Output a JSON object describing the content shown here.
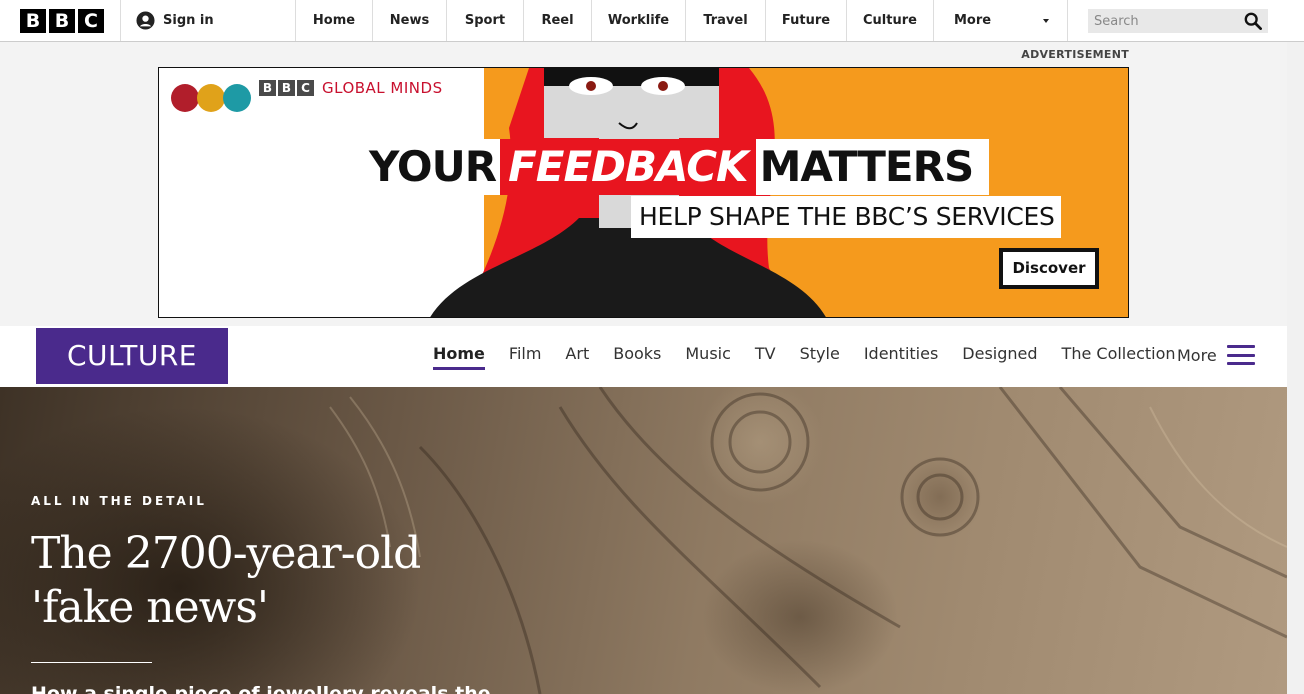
{
  "global_nav": {
    "logo_letters": [
      "B",
      "B",
      "C"
    ],
    "signin_label": "Sign in",
    "links": [
      {
        "label": "Home",
        "width": 77
      },
      {
        "label": "News",
        "width": 74
      },
      {
        "label": "Sport",
        "width": 77
      },
      {
        "label": "Reel",
        "width": 68
      },
      {
        "label": "Worklife",
        "width": 94
      },
      {
        "label": "Travel",
        "width": 80
      },
      {
        "label": "Future",
        "width": 81
      },
      {
        "label": "Culture",
        "width": 87
      }
    ],
    "more_label": "More",
    "search_placeholder": "Search"
  },
  "advertisement": {
    "label": "ADVERTISEMENT",
    "brand_letters": [
      "B",
      "B",
      "C"
    ],
    "brand_name": "GLOBAL MINDS",
    "headline_1": "YOUR",
    "headline_2": "FEEDBACK",
    "headline_3": "MATTERS",
    "subline": "HELP SHAPE THE BBC’S SERVICES",
    "cta": "Discover",
    "colors": {
      "orange": "#f59a1d",
      "red": "#e8151f"
    }
  },
  "culture_nav": {
    "logo": "CULTURE",
    "items": [
      "Home",
      "Film",
      "Art",
      "Books",
      "Music",
      "TV",
      "Style",
      "Identities",
      "Designed",
      "The Collection"
    ],
    "active_item": "Home",
    "more_label": "More",
    "accent": "#4a2a8c"
  },
  "hero": {
    "kicker": "ALL IN THE DETAIL",
    "headline": "The 2700-year-old 'fake news'",
    "subheading": "How a single piece of jewellery reveals the"
  }
}
